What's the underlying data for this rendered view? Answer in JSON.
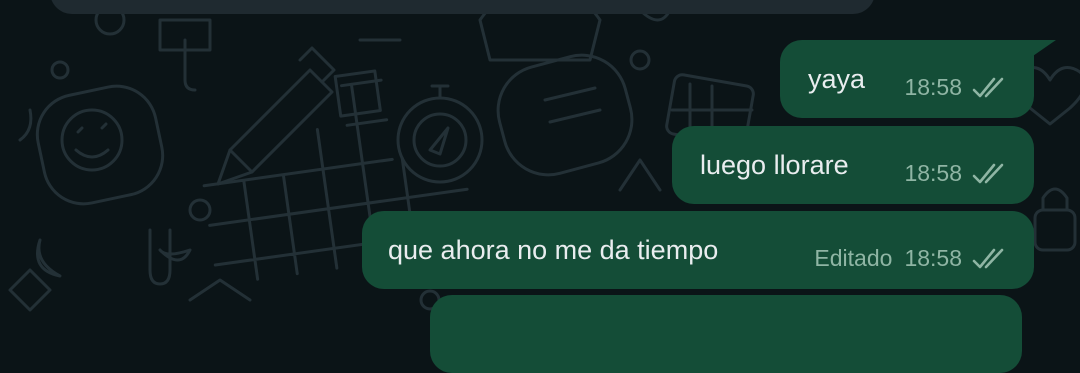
{
  "messages": [
    {
      "text": "yaya",
      "time": "18:58",
      "edited": "",
      "status_icon": "double-check-icon"
    },
    {
      "text": "luego llorare",
      "time": "18:58",
      "edited": "",
      "status_icon": "double-check-icon"
    },
    {
      "text": "que ahora no me da tiempo",
      "time": "18:58",
      "edited": "Editado",
      "status_icon": "double-check-icon"
    }
  ],
  "colors": {
    "background": "#0b1417",
    "outgoing_bubble": "#144d37",
    "incoming_bubble": "#1f2a30",
    "message_text": "#e9edef",
    "meta_text": "#8fb5a4"
  }
}
